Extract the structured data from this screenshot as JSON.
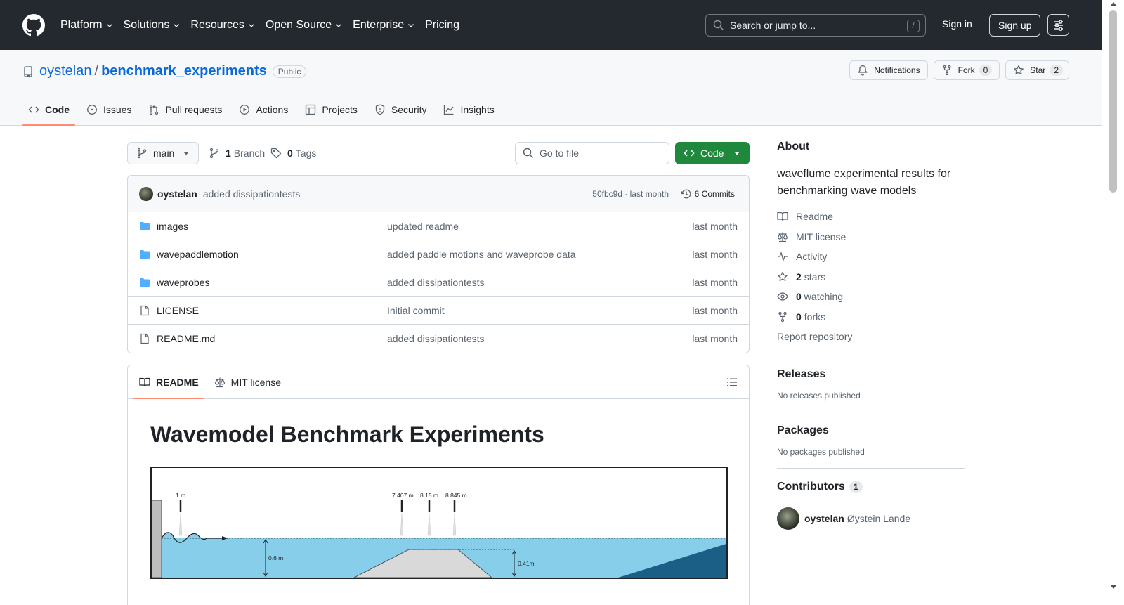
{
  "header": {
    "nav": [
      {
        "label": "Platform",
        "dropdown": true
      },
      {
        "label": "Solutions",
        "dropdown": true
      },
      {
        "label": "Resources",
        "dropdown": true
      },
      {
        "label": "Open Source",
        "dropdown": true
      },
      {
        "label": "Enterprise",
        "dropdown": true
      },
      {
        "label": "Pricing",
        "dropdown": false
      }
    ],
    "search_placeholder": "Search or jump to...",
    "search_shortcut": "/",
    "signin": "Sign in",
    "signup": "Sign up"
  },
  "repo": {
    "owner": "oystelan",
    "separator": "/",
    "name": "benchmark_experiments",
    "visibility": "Public",
    "notifications": "Notifications",
    "fork_label": "Fork",
    "fork_count": "0",
    "star_label": "Star",
    "star_count": "2",
    "tabs": [
      "Code",
      "Issues",
      "Pull requests",
      "Actions",
      "Projects",
      "Security",
      "Insights"
    ]
  },
  "toolbar": {
    "branch": "main",
    "branch_count": "1",
    "branch_label": "Branch",
    "tag_count": "0",
    "tag_label": "Tags",
    "goto_placeholder": "Go to file",
    "code_label": "Code"
  },
  "commit": {
    "author": "oystelan",
    "message": "added dissipationtests",
    "meta": "50fbc9d · last month",
    "count": "6 Commits"
  },
  "files": [
    {
      "name": "images",
      "type": "folder",
      "message": "updated readme",
      "time": "last month"
    },
    {
      "name": "wavepaddlemotion",
      "type": "folder",
      "message": "added paddle motions and waveprobe data",
      "time": "last month"
    },
    {
      "name": "waveprobes",
      "type": "folder",
      "message": "added dissipationtests",
      "time": "last month"
    },
    {
      "name": "LICENSE",
      "type": "file",
      "message": "Initial commit",
      "time": "last month"
    },
    {
      "name": "README.md",
      "type": "file",
      "message": "added dissipationtests",
      "time": "last month"
    }
  ],
  "readme": {
    "tabs": [
      "README",
      "MIT license"
    ],
    "title": "Wavemodel Benchmark Experiments",
    "figure": {
      "probe_1": "1 m",
      "probe_2": "7.407 m",
      "probe_3": "8.15 m",
      "probe_4": "8.845 m",
      "depth": "0.6 m",
      "bar_height": "0.41m"
    }
  },
  "about": {
    "heading": "About",
    "description": "waveflume experimental results for benchmarking wave models",
    "links": [
      {
        "icon": "book-icon",
        "bold": "",
        "text": "Readme"
      },
      {
        "icon": "law-icon",
        "bold": "",
        "text": "MIT license"
      },
      {
        "icon": "pulse-icon",
        "bold": "",
        "text": "Activity"
      },
      {
        "icon": "star-icon",
        "bold": "2",
        "text": "stars"
      },
      {
        "icon": "eye-icon",
        "bold": "0",
        "text": "watching"
      },
      {
        "icon": "fork-icon",
        "bold": "0",
        "text": "forks"
      },
      {
        "icon": "",
        "bold": "",
        "text": "Report repository"
      }
    ]
  },
  "releases": {
    "heading": "Releases",
    "text": "No releases published"
  },
  "packages": {
    "heading": "Packages",
    "text": "No packages published"
  },
  "contributors": {
    "heading": "Contributors",
    "count": "1",
    "user": "oystelan",
    "fullname": "Øystein Lande"
  },
  "colors": {
    "header_bg": "#24292f",
    "link": "#0969da",
    "green": "#1f883d",
    "tab_underline": "#fd8c73",
    "water": "#87ceeb",
    "beach": "#1b5e86"
  }
}
